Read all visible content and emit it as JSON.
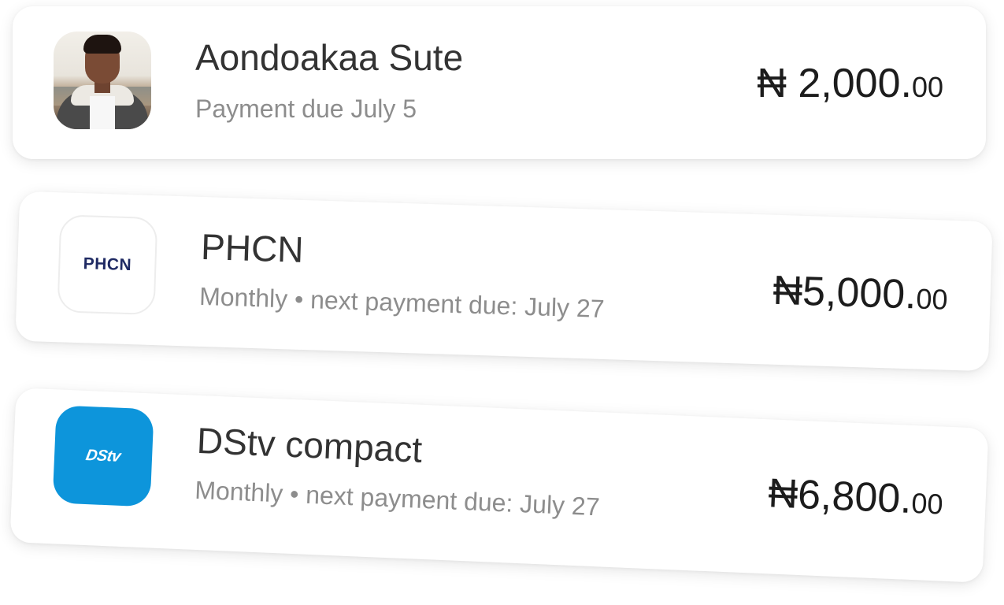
{
  "bills": [
    {
      "name": "Aondoakaa Sute",
      "subtitle": "Payment due July 5",
      "amount_major": "₦ 2,000.",
      "amount_minor": "00",
      "icon": "person-avatar"
    },
    {
      "name": "PHCN",
      "subtitle": "Monthly • next payment due: July 27",
      "amount_major": "₦5,000.",
      "amount_minor": "00",
      "icon": "phcn-logo",
      "logo_text": "PHCN",
      "logo_color": "#1f2a63"
    },
    {
      "name": "DStv compact",
      "subtitle": "Monthly • next payment due: July 27",
      "amount_major": "₦6,800.",
      "amount_minor": "00",
      "icon": "dstv-logo",
      "logo_text": "DStv",
      "logo_color": "#0d95db"
    }
  ],
  "colors": {
    "title_text": "#333333",
    "subtitle_text": "#8d8d8d",
    "amount_text": "#1c1c1c",
    "card_background": "#ffffff"
  }
}
